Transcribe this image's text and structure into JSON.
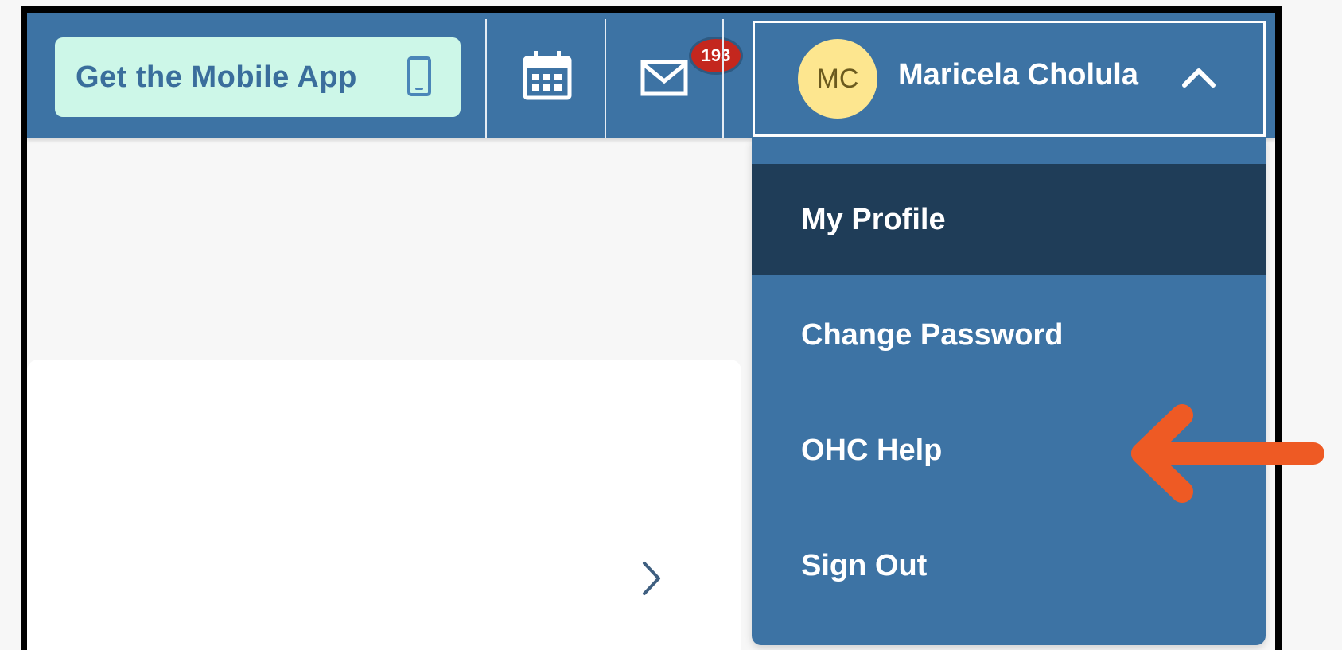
{
  "header": {
    "mobile_app_label": "Get the Mobile App",
    "notification_count": "193",
    "user": {
      "initials": "MC",
      "name": "Maricela Cholula"
    }
  },
  "user_menu": {
    "items": [
      {
        "label": "My Profile",
        "active": true
      },
      {
        "label": "Change Password",
        "active": false
      },
      {
        "label": "OHC Help",
        "active": false
      },
      {
        "label": "Sign Out",
        "active": false
      }
    ]
  },
  "icons": {
    "phone": "mobile-phone-icon",
    "calendar": "calendar-icon",
    "mail": "mail-icon",
    "user_menu_toggle": "chevron-up-icon",
    "card_next": "chevron-right-icon",
    "annotation": "arrow-left-icon"
  },
  "colors": {
    "header_bg": "#3d73a4",
    "menu_active_bg": "#1f3d58",
    "mobile_button_bg": "#cdf7e8",
    "avatar_bg": "#fde68f",
    "badge_bg": "#c4271e",
    "annotation_arrow": "#ee5a24"
  }
}
